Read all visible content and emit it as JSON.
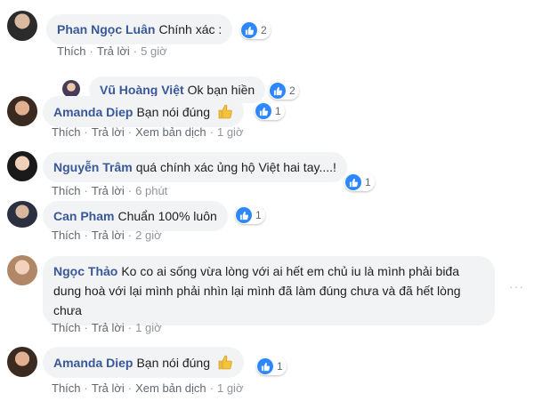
{
  "colors": {
    "author": "#385898",
    "bubble": "#f2f3f5",
    "like": "#2d88ff",
    "meta": "#606770"
  },
  "actions": {
    "like": "Thích",
    "reply": "Trả lời",
    "translate": "Xem bản dịch"
  },
  "comments": [
    {
      "author": "Phan Ngọc Luân",
      "text": "Chính xác :",
      "time": "5 giờ",
      "likes": "2"
    },
    {
      "author": "Vũ Hoàng Việt",
      "text": "Ok bạn hiền",
      "likes": "2"
    },
    {
      "author": "Amanda Diep",
      "text": "Bạn nói đúng",
      "time": "1 giờ",
      "likes": "1"
    },
    {
      "author": "Nguyễn Trâm",
      "text": "quá chính xác ủng hộ Việt hai tay....!",
      "time": "6 phút",
      "likes": "1"
    },
    {
      "author": "Can Pham",
      "text": "Chuẩn 100% luôn",
      "time": "2 giờ",
      "likes": "1"
    },
    {
      "author": "Ngọc Thảo",
      "text": "Ko co ai sống vừa lòng với ai hết em chủ iu là mình phải biđa dung hoà với lại mình phải nhìn lại mình đã làm đúng chưa và đã hết lòng chưa",
      "time": "1 giờ"
    },
    {
      "author": "Amanda Diep",
      "text": "Bạn nói đúng",
      "time": "1 giờ",
      "likes": "1"
    }
  ]
}
